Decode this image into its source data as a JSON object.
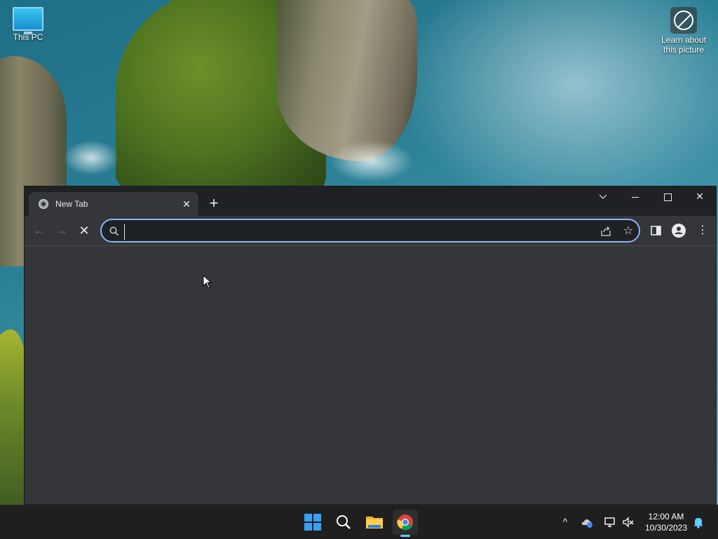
{
  "desktop": {
    "icons": [
      {
        "label": "This PC"
      },
      {
        "label": "Learn about this picture"
      }
    ]
  },
  "browser": {
    "tab": {
      "title": "New Tab",
      "close_symbol": "✕"
    },
    "new_tab_symbol": "+",
    "window_controls": {
      "tab_search": "⌄",
      "close": "✕"
    },
    "nav": {
      "back": "←",
      "forward": "→",
      "stop": "✕"
    },
    "omnibox": {
      "value": "",
      "placeholder": ""
    },
    "star": "☆",
    "menu": "⋮",
    "accent_color": "#8ab4f8"
  },
  "taskbar": {
    "apps": [
      "start-button",
      "search-button",
      "file-explorer",
      "google-chrome"
    ],
    "tray": {
      "chevron": "^"
    },
    "clock": {
      "time": "12:00 AM",
      "date": "10/30/2023"
    }
  }
}
